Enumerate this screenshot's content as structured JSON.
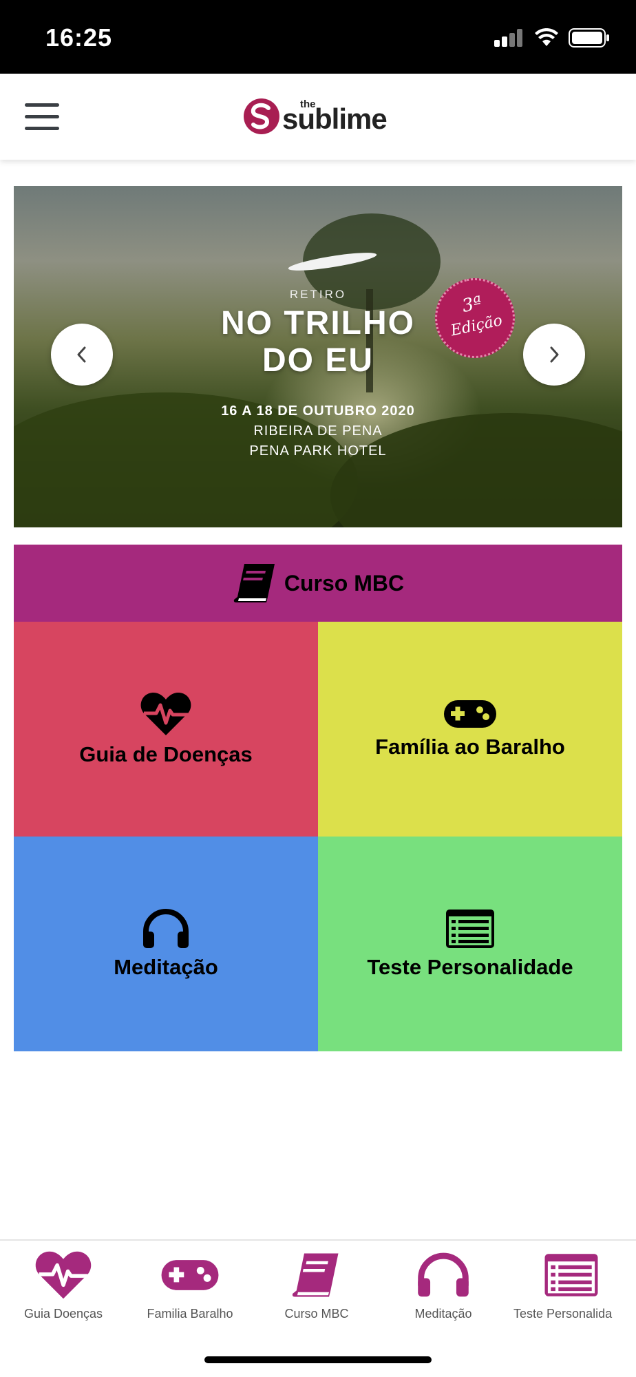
{
  "status_bar": {
    "time": "16:25"
  },
  "header": {
    "logo_small": "the",
    "logo_word": "sublime"
  },
  "banner": {
    "retiro": "RETIRO",
    "title_line1": "NO TRILHO",
    "title_line2": "DO EU",
    "edition_line1": "3ª",
    "edition_line2": "Edição",
    "dates": "16 A 18 DE OUTUBRO 2020",
    "place": "RIBEIRA DE PENA",
    "hotel": "PENA PARK HOTEL"
  },
  "menu": {
    "course": "Curso MBC",
    "tiles": [
      {
        "label": "Guia de Doenças",
        "color": "#d74560"
      },
      {
        "label": "Família ao Baralho",
        "color": "#dce04b"
      },
      {
        "label": "Meditação",
        "color": "#518ee6"
      },
      {
        "label": "Teste Personalidade",
        "color": "#78e07e"
      }
    ],
    "course_color": "#a5297d"
  },
  "tabs": [
    {
      "label": "Guia Doenças",
      "icon": "heart-pulse-icon"
    },
    {
      "label": "Familia Baralho",
      "icon": "gamepad-icon"
    },
    {
      "label": "Curso MBC",
      "icon": "book-icon"
    },
    {
      "label": "Meditação",
      "icon": "headphones-icon"
    },
    {
      "label": "Teste Personalida",
      "icon": "list-alt-icon"
    }
  ],
  "colors": {
    "accent": "#a5297d"
  }
}
